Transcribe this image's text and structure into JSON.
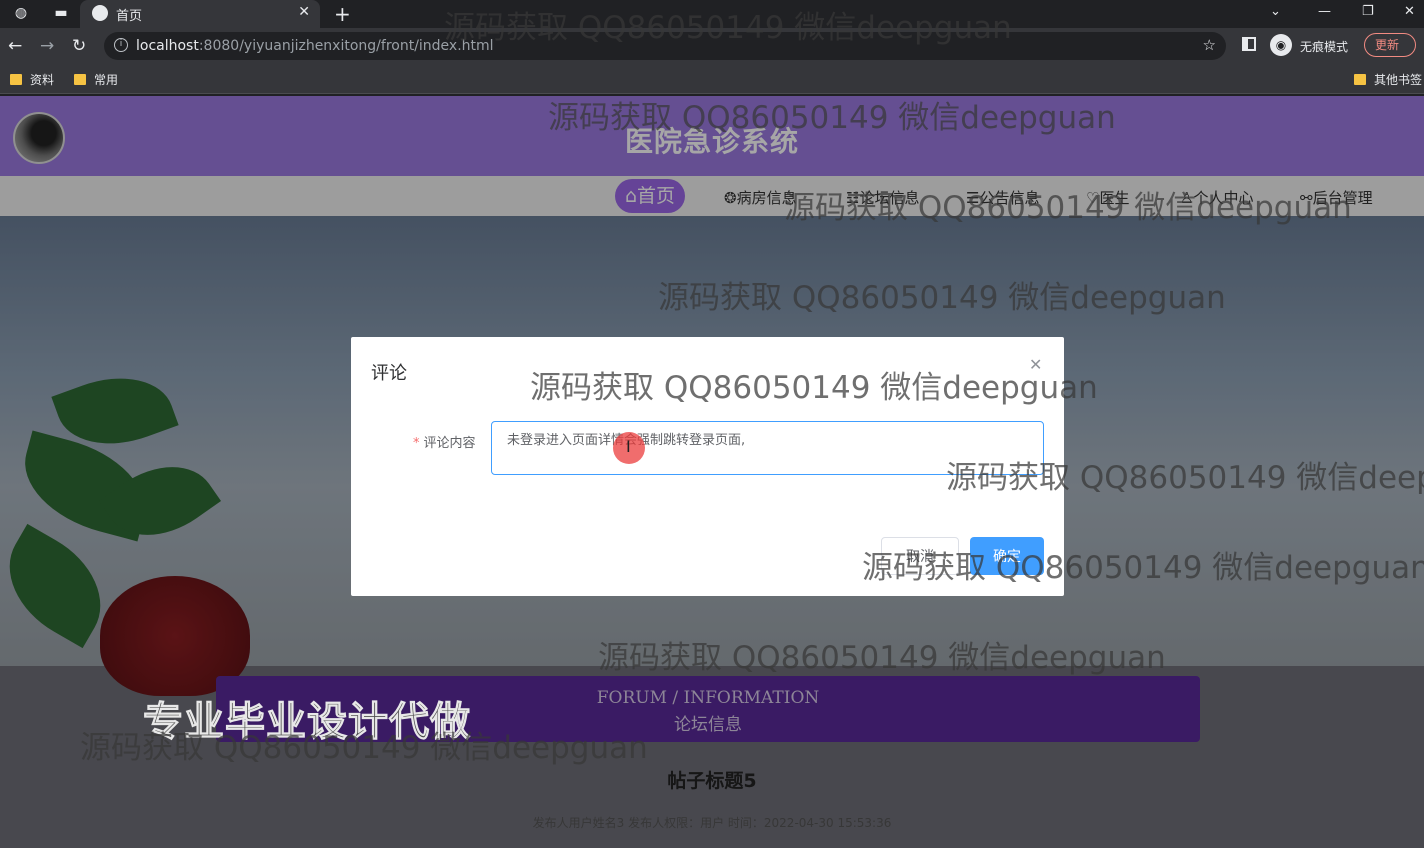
{
  "browser": {
    "tab_title": "首页",
    "url_host": "localhost",
    "url_rest": ":8080/yiyuanjizhenxitong/front/index.html",
    "incognito_label": "无痕模式",
    "update_label": "更新",
    "bookmarks": [
      "资料",
      "常用"
    ],
    "other_bookmarks": "其他书签"
  },
  "site": {
    "title": "医院急诊系统",
    "nav": [
      {
        "icon": "home-icon",
        "label": "⌂首页"
      },
      {
        "icon": "ward-icon",
        "label": "病房信息"
      },
      {
        "icon": "forum-icon",
        "label": "论坛信息"
      },
      {
        "icon": "notice-icon",
        "label": "公告信息"
      },
      {
        "icon": "doctor-icon",
        "label": "医生"
      },
      {
        "icon": "user-icon",
        "label": "个人中心"
      },
      {
        "icon": "link-icon",
        "label": "后台管理"
      }
    ]
  },
  "forum": {
    "title_en": "FORUM / INFORMATION",
    "title_cn": "论坛信息"
  },
  "post": {
    "title": "帖子标题5",
    "meta": "发布人用户姓名3    发布人权限：用户    时间：2022-04-30 15:53:36"
  },
  "dialog": {
    "title": "评论",
    "field_label": "评论内容",
    "field_value": "未登录进入页面详情会强制跳转登录页面,",
    "cancel_label": "取消",
    "ok_label": "确定"
  },
  "overlay": {
    "ad_text": "专业毕业设计代做",
    "watermark": "源码获取 QQ86050149 微信deepguan"
  }
}
